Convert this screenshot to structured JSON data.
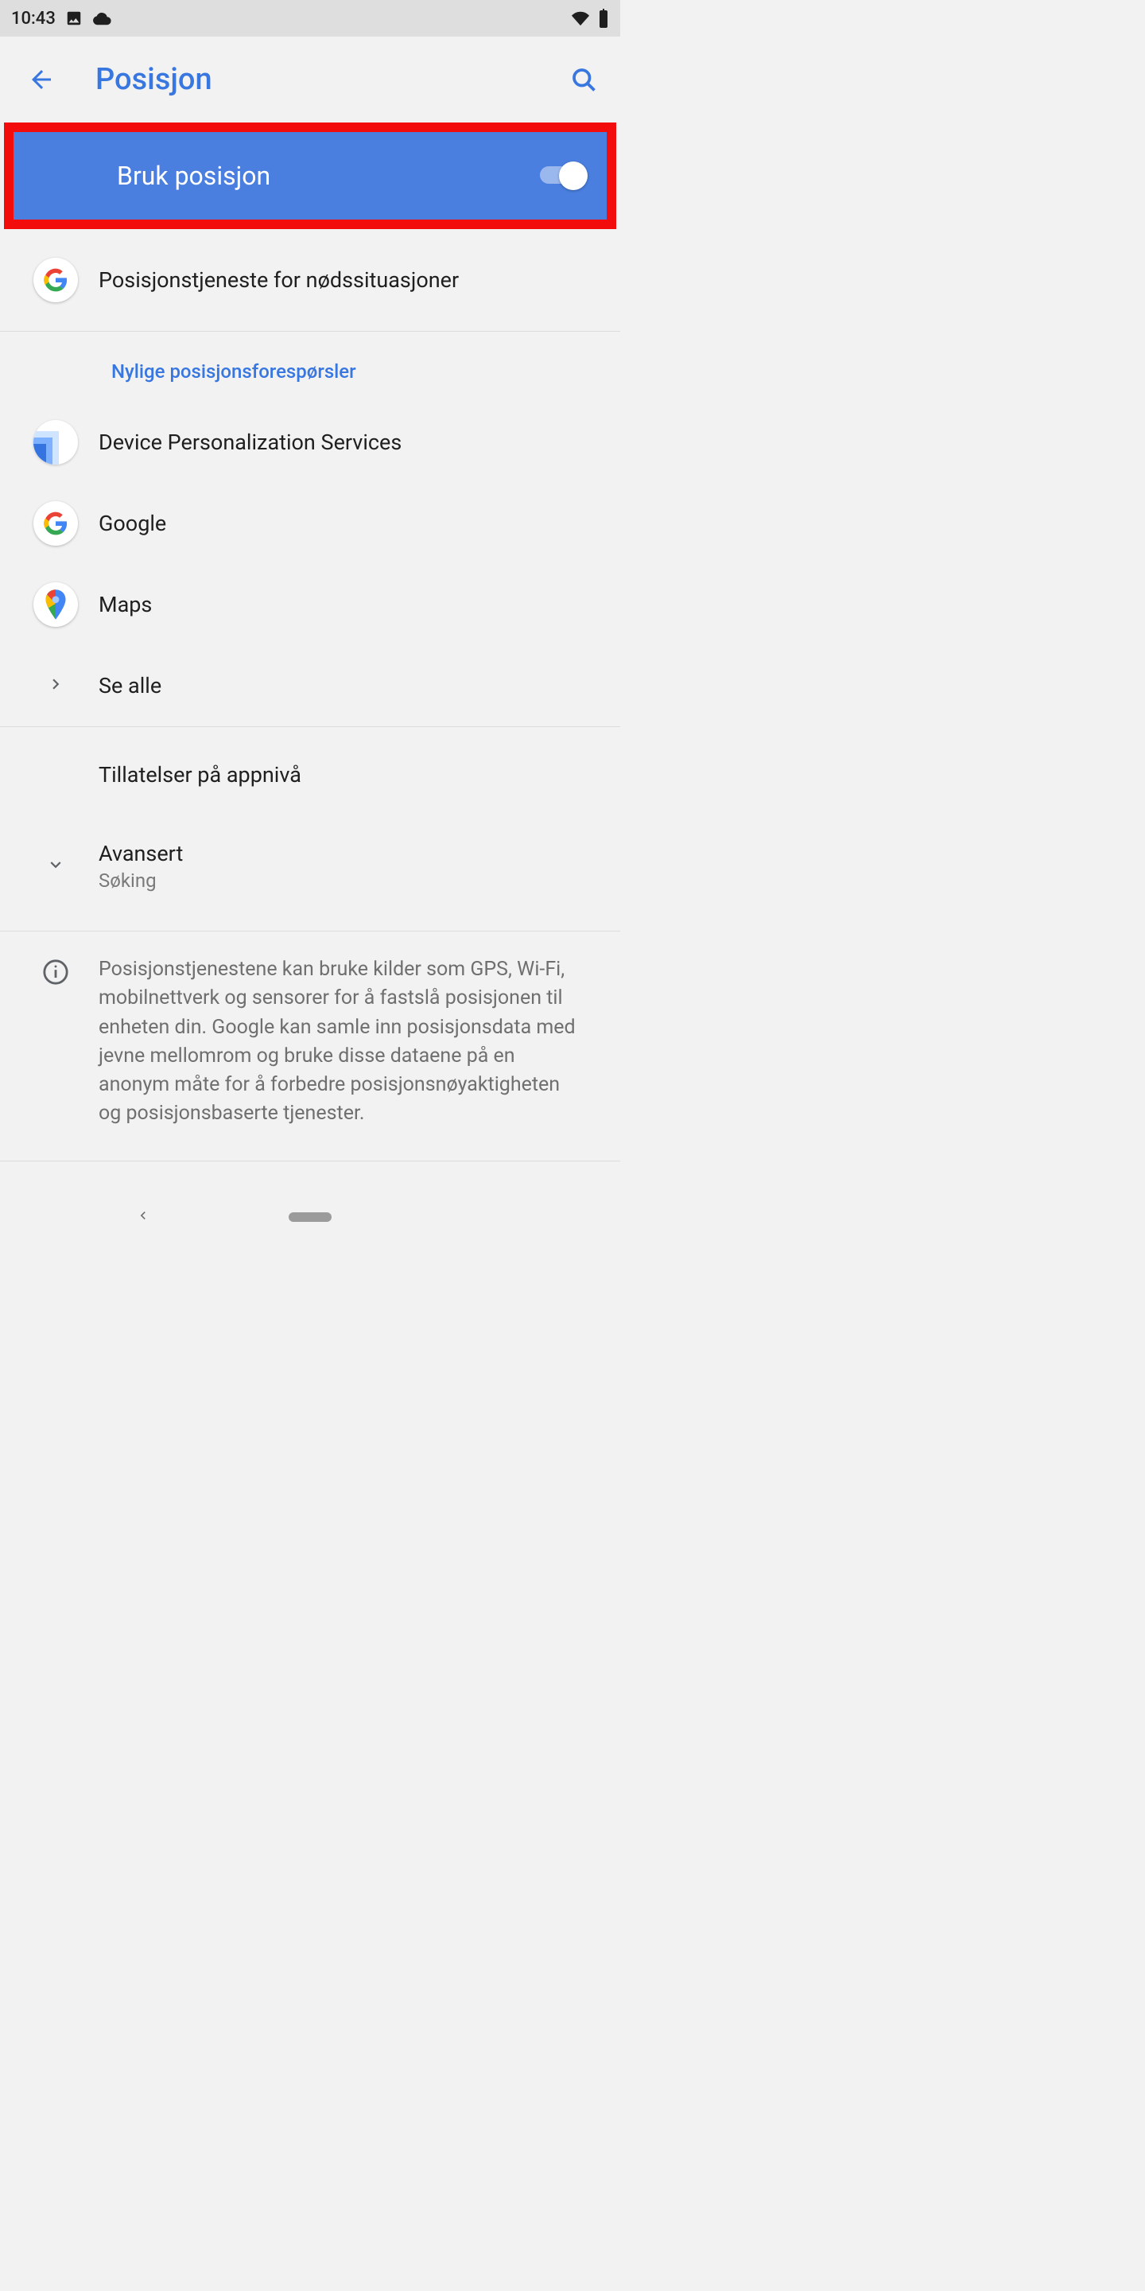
{
  "statusbar": {
    "time": "10:43"
  },
  "appbar": {
    "title": "Posisjon"
  },
  "toggle": {
    "label": "Bruk posisjon",
    "on": true
  },
  "emergency": {
    "label": "Posisjonstjeneste for nødssituasjoner"
  },
  "section_recent": "Nylige posisjonsforespørsler",
  "apps": {
    "dps": "Device Personalization Services",
    "google": "Google",
    "maps": "Maps",
    "see_all": "Se alle"
  },
  "app_permissions": "Tillatelser på appnivå",
  "advanced": {
    "title": "Avansert",
    "subtitle": "Søking"
  },
  "info_text": "Posisjonstjenestene kan bruke kilder som GPS, Wi-Fi, mobilnettverk og sensorer for å fastslå posisjonen til enheten din. Google kan samle inn posisjonsdata med jevne mellomrom og bruke disse dataene på en anonym måte for å forbedre posisjonsnøyaktigheten og posisjonsbaserte tjenester."
}
